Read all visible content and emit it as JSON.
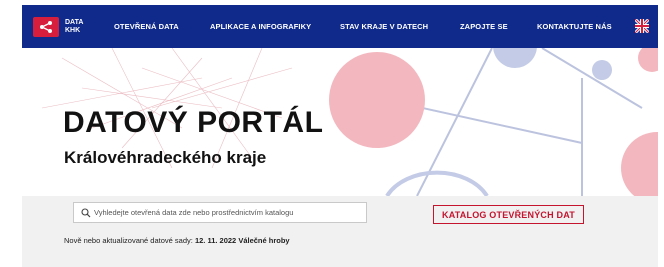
{
  "navbar": {
    "logo_line1": "DATA",
    "logo_line2": "KHK",
    "items": [
      {
        "label": "OTEVŘENÁ DATA"
      },
      {
        "label": "APLIKACE A INFOGRAFIKY"
      },
      {
        "label": "STAV KRAJE V DATECH"
      },
      {
        "label": "ZAPOJTE SE"
      },
      {
        "label": "KONTAKTUJTE NÁS"
      }
    ],
    "language_icon": "uk-flag-icon"
  },
  "hero": {
    "title": "DATOVÝ PORTÁL",
    "subtitle": "Královéhradeckého kraje"
  },
  "search": {
    "placeholder": "Vyhledejte otevřená data zde nebo prostřednictvím katalogu",
    "value": ""
  },
  "catalog_button": {
    "label": "KATALOG OTEVŘENÝCH DAT"
  },
  "updates": {
    "prefix": "Nově nebo aktualizované datové sady:",
    "date": "12. 11. 2022",
    "dataset": "Válečné hroby"
  },
  "colors": {
    "nav_bg": "#0f2a8a",
    "brand_red": "#c4142e",
    "circle_pink": "#f3b8bf",
    "circle_blue": "#c3cbe6"
  }
}
